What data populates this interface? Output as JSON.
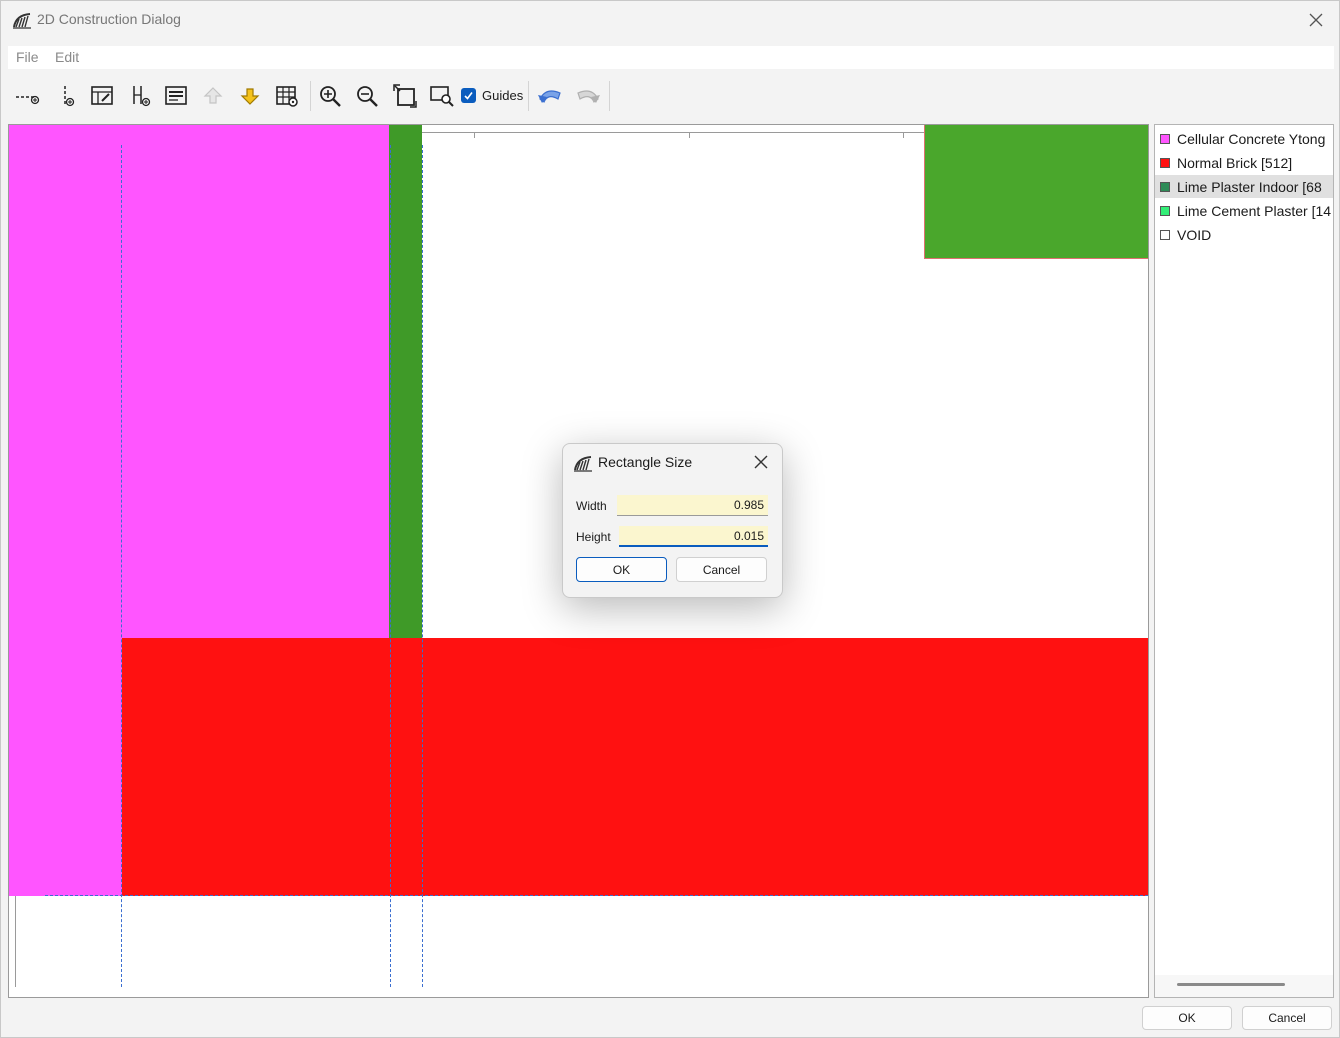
{
  "window": {
    "title": "2D Construction Dialog"
  },
  "menu": {
    "file": "File",
    "edit": "Edit"
  },
  "toolbar": {
    "guides_label": "Guides",
    "guides_checked": true
  },
  "materials": [
    {
      "label": "Cellular Concrete Ytong",
      "color": "#ff55ff",
      "selected": false
    },
    {
      "label": "Normal Brick [512]",
      "color": "#ff1111",
      "selected": false
    },
    {
      "label": "Lime Plaster Indoor [68",
      "color": "#2e8b57",
      "selected": true
    },
    {
      "label": "Lime Cement Plaster [14",
      "color": "#33ee77",
      "selected": false
    },
    {
      "label": "VOID",
      "color": "#ffffff",
      "selected": false
    }
  ],
  "colors": {
    "cellular_concrete": "#ff55ff",
    "normal_brick": "#ff1111",
    "lime_plaster": "#3f9a28",
    "green_block": "#4aa72c",
    "accent": "#0a5cbe"
  },
  "popup": {
    "title": "Rectangle Size",
    "width_label": "Width",
    "width_value": "0.985",
    "height_label": "Height",
    "height_value": "0.015",
    "ok_label": "OK",
    "cancel_label": "Cancel"
  },
  "footer": {
    "ok_label": "OK",
    "cancel_label": "Cancel"
  }
}
